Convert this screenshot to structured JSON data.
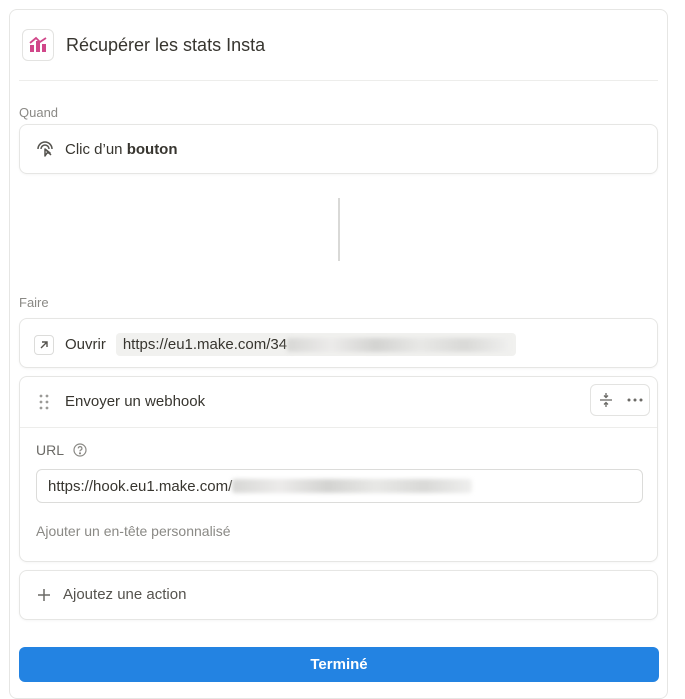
{
  "header": {
    "title": "Récupérer les stats Insta",
    "icon": "chart-icon",
    "icon_color": "#d1478a"
  },
  "when": {
    "label": "Quand",
    "trigger_text": "Clic d’un",
    "trigger_bold": "bouton",
    "icon": "cursor-click-icon"
  },
  "do": {
    "label": "Faire",
    "open_action": {
      "label": "Ouvrir",
      "url": "https://eu1.make.com/34",
      "icon": "arrow-up-right-icon"
    },
    "webhook_action": {
      "label": "Envoyer un webhook",
      "url_label": "URL",
      "url_value": "https://hook.eu1.make.com/",
      "add_header": "Ajouter un en-tête personnalisé"
    },
    "add_action": "Ajoutez une action"
  },
  "footer": {
    "done_label": "Terminé",
    "accent": "#2383e2"
  }
}
